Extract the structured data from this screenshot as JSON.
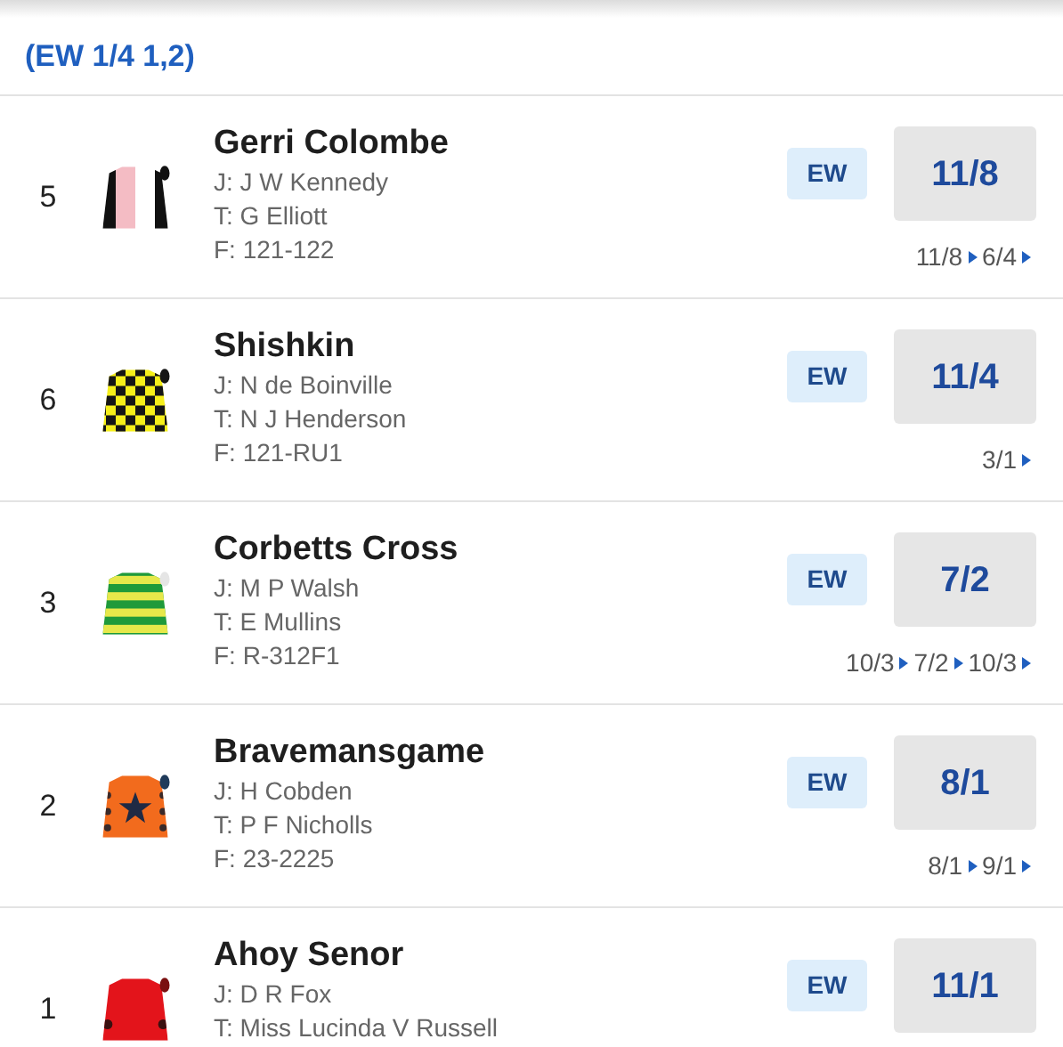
{
  "terms": "(EW 1/4 1,2)",
  "runners": [
    {
      "number": "5",
      "silk": {
        "kind": "halves"
      },
      "name": "Gerri Colombe",
      "jockey": "J: J W Kennedy",
      "trainer": "T: G Elliott",
      "form": "F: 121-122",
      "ew": "EW",
      "price": "11/8",
      "history": [
        "11/8",
        "6/4"
      ]
    },
    {
      "number": "6",
      "silk": {
        "kind": "check"
      },
      "name": "Shishkin",
      "jockey": "J: N de Boinville",
      "trainer": "T: N J Henderson",
      "form": "F: 121-RU1",
      "ew": "EW",
      "price": "11/4",
      "history": [
        "3/1"
      ]
    },
    {
      "number": "3",
      "silk": {
        "kind": "hoops"
      },
      "name": "Corbetts Cross",
      "jockey": "J: M P Walsh",
      "trainer": "T: E Mullins",
      "form": "F: R-312F1",
      "ew": "EW",
      "price": "7/2",
      "history": [
        "10/3",
        "7/2",
        "10/3"
      ]
    },
    {
      "number": "2",
      "silk": {
        "kind": "star"
      },
      "name": "Bravemansgame",
      "jockey": "J: H Cobden",
      "trainer": "T: P F Nicholls",
      "form": "F: 23-2225",
      "ew": "EW",
      "price": "8/1",
      "history": [
        "8/1",
        "9/1"
      ]
    },
    {
      "number": "1",
      "silk": {
        "kind": "plain"
      },
      "name": "Ahoy Senor",
      "jockey": "J: D R Fox",
      "trainer": "T: Miss Lucinda V Russell",
      "ew": "EW",
      "price": "11/1"
    }
  ]
}
